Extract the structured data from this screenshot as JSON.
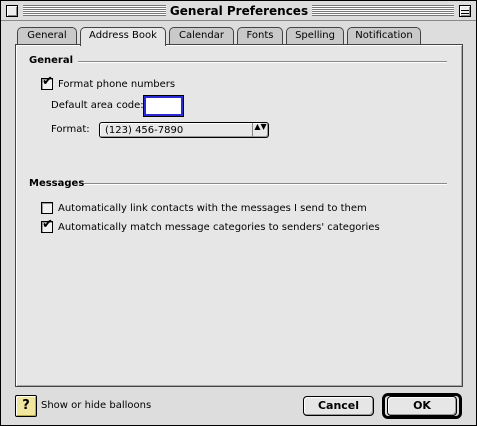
{
  "window": {
    "title": "General Preferences"
  },
  "tabs": [
    {
      "label": "General",
      "active": false
    },
    {
      "label": "Address Book",
      "active": true
    },
    {
      "label": "Calendar",
      "active": false
    },
    {
      "label": "Fonts",
      "active": false
    },
    {
      "label": "Spelling",
      "active": false
    },
    {
      "label": "Notification",
      "active": false
    }
  ],
  "general": {
    "heading": "General",
    "format_phone": {
      "label": "Format phone numbers",
      "checked": true,
      "mark": "✔"
    },
    "area_code": {
      "label": "Default area code:",
      "value": ""
    },
    "format": {
      "label": "Format:",
      "value": "(123) 456-7890",
      "arrows": "▲▼"
    }
  },
  "messages": {
    "heading": "Messages",
    "auto_link": {
      "label": "Automatically link contacts with the messages I send to them",
      "checked": false,
      "mark": ""
    },
    "auto_match": {
      "label": "Automatically match message categories to senders' categories",
      "checked": true,
      "mark": "✔"
    }
  },
  "footer": {
    "help_icon_glyph": "?",
    "balloons_label": "Show or hide balloons",
    "cancel_label": "Cancel",
    "ok_label": "OK"
  }
}
